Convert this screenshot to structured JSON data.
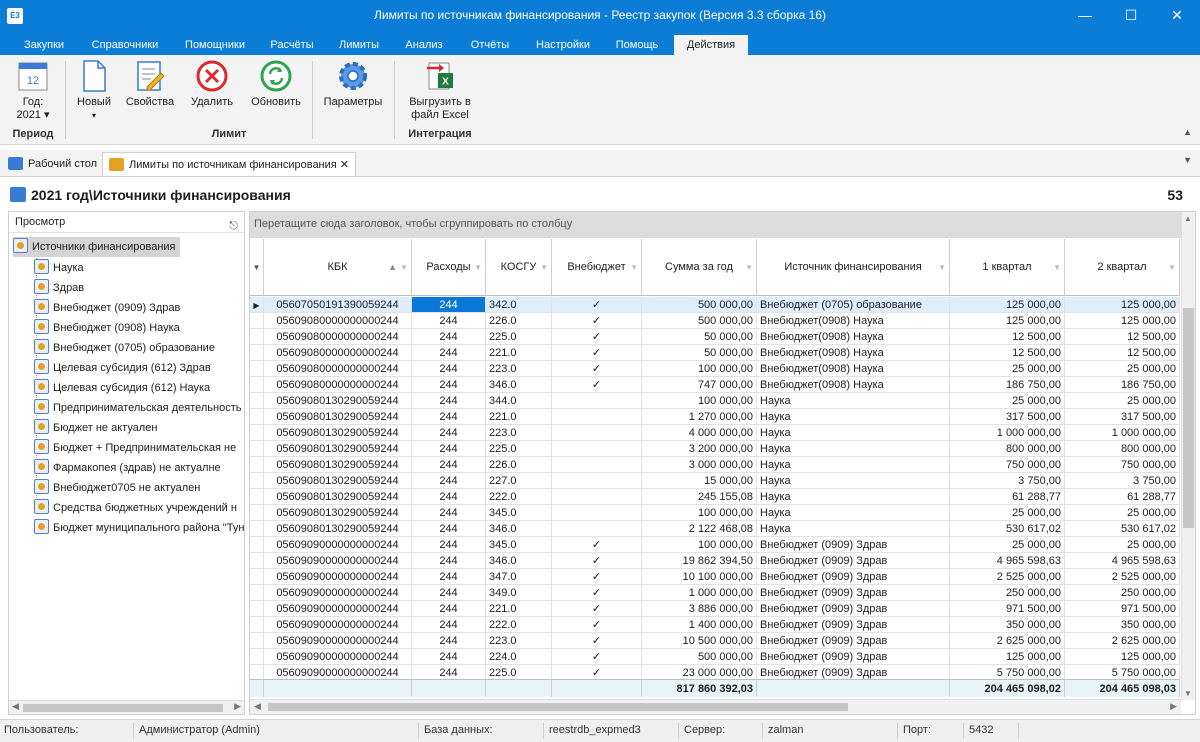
{
  "window": {
    "title": "Лимиты по источникам финансирования - Реестр закупок (Версия 3.3 сборка 16)",
    "app_icon_label": "E3"
  },
  "menu": [
    "Закупки",
    "Справочники",
    "Помощники",
    "Расчёты",
    "Лимиты",
    "Анализ",
    "Отчёты",
    "Настройки",
    "Помощь",
    "Действия"
  ],
  "ribbon": {
    "year_label": "Год:",
    "year_value": "2021",
    "calendar_day": "12",
    "new": "Новый",
    "props": "Свойства",
    "delete": "Удалить",
    "refresh": "Обновить",
    "params": "Параметры",
    "export": "Выгрузить в файл Excel",
    "groups": {
      "period": "Период",
      "limit": "Лимит",
      "integration": "Интеграция"
    }
  },
  "tabs": {
    "desktop": "Рабочий стол",
    "limits": "Лимиты по источникам финансирования"
  },
  "header": {
    "title": "2021 год\\Источники финансирования",
    "count": "53"
  },
  "left": {
    "head": "Просмотр",
    "root": "Источники финансирования",
    "items": [
      "Наука",
      "Здрав",
      "Внебюджет (0909) Здрав",
      "Внебюджет (0908) Наука",
      "Внебюджет (0705) образование",
      "Целевая субсидия (612) Здрав",
      "Целевая субсидия (612) Наука",
      "Предпринимательская деятельность",
      "Бюджет не актуален",
      "Бюджет + Предпринимательская не",
      "Фармакопея (здрав) не актуалне",
      "Внебюджет0705 не актуален",
      "Средства бюджетных учреждений н",
      "Бюджет муниципального района \"Тун"
    ]
  },
  "grid": {
    "group_hint": "Перетащите сюда заголовок, чтобы сгруппировать по столбцу",
    "columns": [
      "КБК",
      "Расходы",
      "КОСГУ",
      "Внебюджет",
      "Сумма за год",
      "Источник финансирования",
      "1 квартал",
      "2 квартал"
    ],
    "rows": [
      [
        "0560705019139005924​4",
        "244",
        "342.0",
        "✓",
        "500 000,00",
        "Внебюджет (0705) образование",
        "125 000,00",
        "125 000,00"
      ],
      [
        "05609080000000000244",
        "244",
        "226.0",
        "✓",
        "500 000,00",
        "Внебюджет(0908) Наука",
        "125 000,00",
        "125 000,00"
      ],
      [
        "05609080000000000244",
        "244",
        "225.0",
        "✓",
        "50 000,00",
        "Внебюджет(0908) Наука",
        "12 500,00",
        "12 500,00"
      ],
      [
        "05609080000000000244",
        "244",
        "221.0",
        "✓",
        "50 000,00",
        "Внебюджет(0908) Наука",
        "12 500,00",
        "12 500,00"
      ],
      [
        "05609080000000000244",
        "244",
        "223.0",
        "✓",
        "100 000,00",
        "Внебюджет(0908) Наука",
        "25 000,00",
        "25 000,00"
      ],
      [
        "05609080000000000244",
        "244",
        "346.0",
        "✓",
        "747 000,00",
        "Внебюджет(0908) Наука",
        "186 750,00",
        "186 750,00"
      ],
      [
        "05609080130290059244",
        "244",
        "344.0",
        "",
        "100 000,00",
        "Наука",
        "25 000,00",
        "25 000,00"
      ],
      [
        "05609080130290059244",
        "244",
        "221.0",
        "",
        "1 270 000,00",
        "Наука",
        "317 500,00",
        "317 500,00"
      ],
      [
        "05609080130290059244",
        "244",
        "223.0",
        "",
        "4 000 000,00",
        "Наука",
        "1 000 000,00",
        "1 000 000,00"
      ],
      [
        "05609080130290059244",
        "244",
        "225.0",
        "",
        "3 200 000,00",
        "Наука",
        "800 000,00",
        "800 000,00"
      ],
      [
        "05609080130290059244",
        "244",
        "226.0",
        "",
        "3 000 000,00",
        "Наука",
        "750 000,00",
        "750 000,00"
      ],
      [
        "05609080130290059244",
        "244",
        "227.0",
        "",
        "15 000,00",
        "Наука",
        "3 750,00",
        "3 750,00"
      ],
      [
        "05609080130290059244",
        "244",
        "222.0",
        "",
        "245 155,08",
        "Наука",
        "61 288,77",
        "61 288,77"
      ],
      [
        "05609080130290059244",
        "244",
        "345.0",
        "",
        "100 000,00",
        "Наука",
        "25 000,00",
        "25 000,00"
      ],
      [
        "05609080130290059244",
        "244",
        "346.0",
        "",
        "2 122 468,08",
        "Наука",
        "530 617,02",
        "530 617,02"
      ],
      [
        "05609090000000000244",
        "244",
        "345.0",
        "✓",
        "100 000,00",
        "Внебюджет (0909) Здрав",
        "25 000,00",
        "25 000,00"
      ],
      [
        "05609090000000000244",
        "244",
        "346.0",
        "✓",
        "19 862 394,50",
        "Внебюджет (0909) Здрав",
        "4 965 598,63",
        "4 965 598,63"
      ],
      [
        "05609090000000000244",
        "244",
        "347.0",
        "✓",
        "10 100 000,00",
        "Внебюджет (0909) Здрав",
        "2 525 000,00",
        "2 525 000,00"
      ],
      [
        "05609090000000000244",
        "244",
        "349.0",
        "✓",
        "1 000 000,00",
        "Внебюджет (0909) Здрав",
        "250 000,00",
        "250 000,00"
      ],
      [
        "05609090000000000244",
        "244",
        "221.0",
        "✓",
        "3 886 000,00",
        "Внебюджет (0909) Здрав",
        "971 500,00",
        "971 500,00"
      ],
      [
        "05609090000000000244",
        "244",
        "222.0",
        "✓",
        "1 400 000,00",
        "Внебюджет (0909) Здрав",
        "350 000,00",
        "350 000,00"
      ],
      [
        "05609090000000000244",
        "244",
        "223.0",
        "✓",
        "10 500 000,00",
        "Внебюджет (0909) Здрав",
        "2 625 000,00",
        "2 625 000,00"
      ],
      [
        "05609090000000000244",
        "244",
        "224.0",
        "✓",
        "500 000,00",
        "Внебюджет (0909) Здрав",
        "125 000,00",
        "125 000,00"
      ],
      [
        "05609090000000000244",
        "244",
        "225.0",
        "✓",
        "23 000 000,00",
        "Внебюджет (0909) Здрав",
        "5 750 000,00",
        "5 750 000,00"
      ]
    ],
    "totals": {
      "sum": "817 860 392,03",
      "q1": "204 465 098,02",
      "q2": "204 465 098,03"
    }
  },
  "status": {
    "user_label": "Пользователь:",
    "user": "Администратор (Admin)",
    "db_label": "База данных:",
    "db": "reestrdb_expmed3",
    "server_label": "Сервер:",
    "server": "zalman",
    "port_label": "Порт:",
    "port": "5432"
  }
}
